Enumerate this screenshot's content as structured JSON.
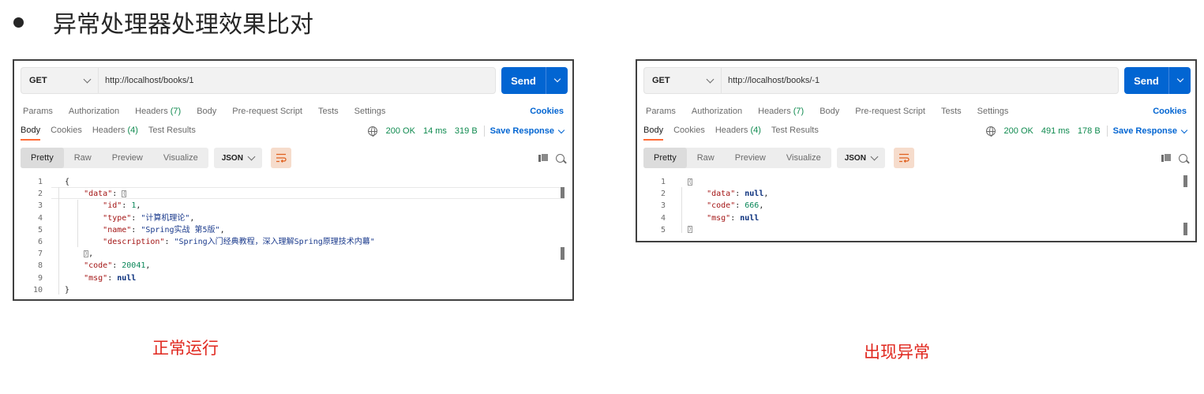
{
  "slide": {
    "title": "异常处理器处理效果比对"
  },
  "panels": [
    {
      "method": "GET",
      "url": "http://localhost/books/1",
      "send_label": "Send",
      "request_tabs": [
        "Params",
        "Authorization",
        "Headers",
        "Body",
        "Pre-request Script",
        "Tests",
        "Settings"
      ],
      "headers_count": "(7)",
      "cookies_link": "Cookies",
      "response_tabs": [
        "Body",
        "Cookies",
        "Headers",
        "Test Results"
      ],
      "response_headers_count": "(4)",
      "status": "200 OK",
      "time": "14 ms",
      "size": "319 B",
      "save_response": "Save Response",
      "view_modes": [
        "Pretty",
        "Raw",
        "Preview",
        "Visualize"
      ],
      "format": "JSON",
      "caption": "正常运行"
    },
    {
      "method": "GET",
      "url": "http://localhost/books/-1",
      "send_label": "Send",
      "request_tabs": [
        "Params",
        "Authorization",
        "Headers",
        "Body",
        "Pre-request Script",
        "Tests",
        "Settings"
      ],
      "headers_count": "(7)",
      "cookies_link": "Cookies",
      "response_tabs": [
        "Body",
        "Cookies",
        "Headers",
        "Test Results"
      ],
      "response_headers_count": "(4)",
      "status": "200 OK",
      "time": "491 ms",
      "size": "178 B",
      "save_response": "Save Response",
      "view_modes": [
        "Pretty",
        "Raw",
        "Preview",
        "Visualize"
      ],
      "format": "JSON",
      "caption": "出现异常"
    }
  ],
  "code_left": {
    "line_numbers": [
      "1",
      "2",
      "3",
      "4",
      "5",
      "6",
      "7",
      "8",
      "9",
      "10"
    ],
    "open_brace": "{",
    "data_key": "\"data\"",
    "id_key": "\"id\"",
    "id_val": "1",
    "type_key": "\"type\"",
    "type_val": "\"计算机理论\"",
    "name_key": "\"name\"",
    "name_val": "\"Spring实战 第5版\"",
    "desc_key": "\"description\"",
    "desc_val": "\"Spring入门经典教程，深入理解Spring原理技术内幕\"",
    "code_key": "\"code\"",
    "code_val": "20041",
    "msg_key": "\"msg\"",
    "msg_val": "null",
    "close_brace": "}"
  },
  "code_right": {
    "line_numbers": [
      "1",
      "2",
      "3",
      "4",
      "5"
    ],
    "data_key": "\"data\"",
    "data_val": "null",
    "code_key": "\"code\"",
    "code_val": "666",
    "msg_key": "\"msg\"",
    "msg_val": "null"
  }
}
